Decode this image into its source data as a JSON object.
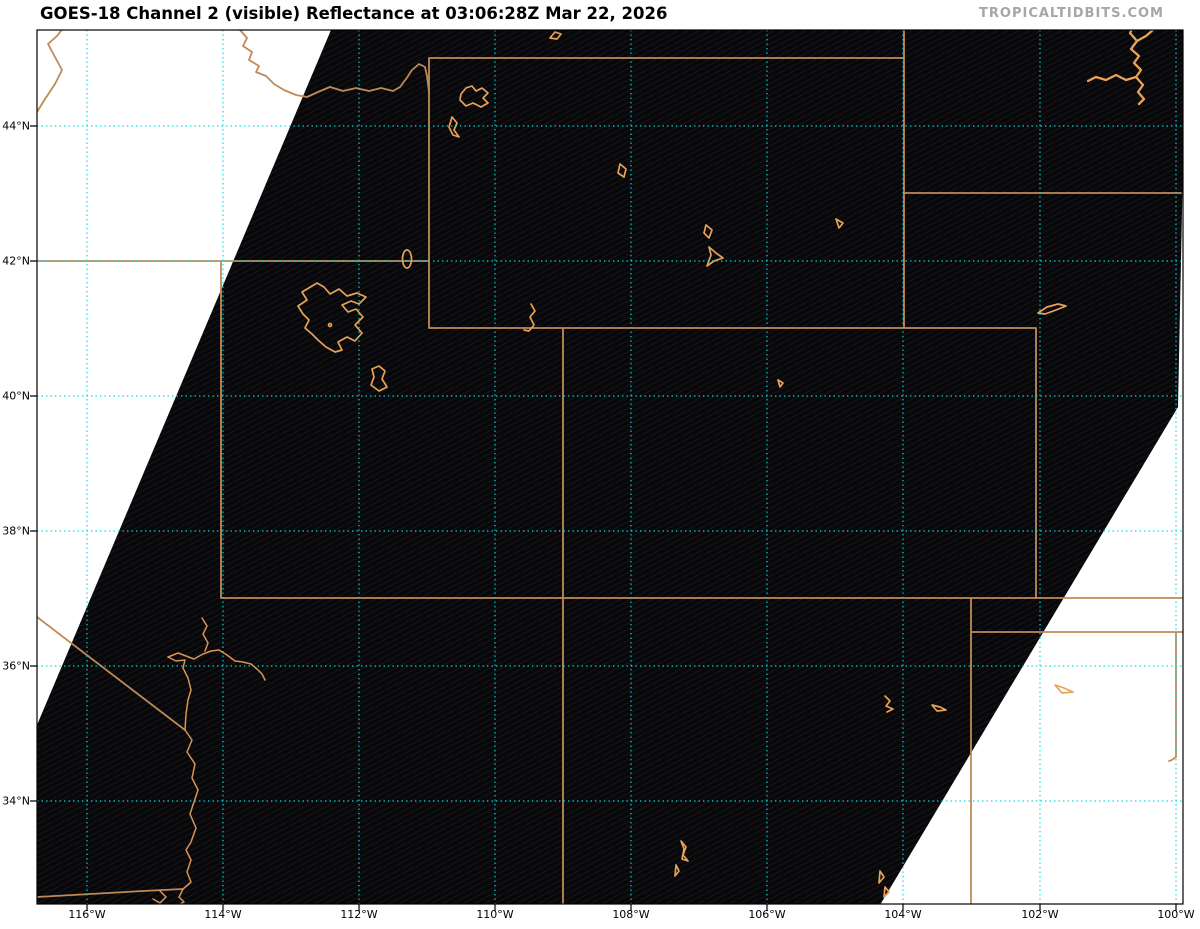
{
  "header": {
    "title": "GOES-18 Channel 2 (visible) Reflectance at 03:06:28Z Mar 22, 2026",
    "watermark": "TROPICALTIDBITS.COM"
  },
  "axes": {
    "lat_tick_labels": [
      "44°N",
      "42°N",
      "40°N",
      "38°N",
      "36°N",
      "34°N"
    ],
    "lon_tick_labels": [
      "116°W",
      "114°W",
      "112°W",
      "110°W",
      "108°W",
      "106°W",
      "104°W",
      "102°W",
      "100°W"
    ]
  },
  "colors": {
    "page_background": "#ffffff",
    "satellite_night_black": "#08080a",
    "scanline_texture": "#1c1c24",
    "state_border_orange": "#c08a58",
    "lake_outline_orange": "#e8a257",
    "graticule_cyan": "#00dcdc",
    "axis_frame_black": "#000000",
    "watermark_gray": "#a6a6a6"
  }
}
